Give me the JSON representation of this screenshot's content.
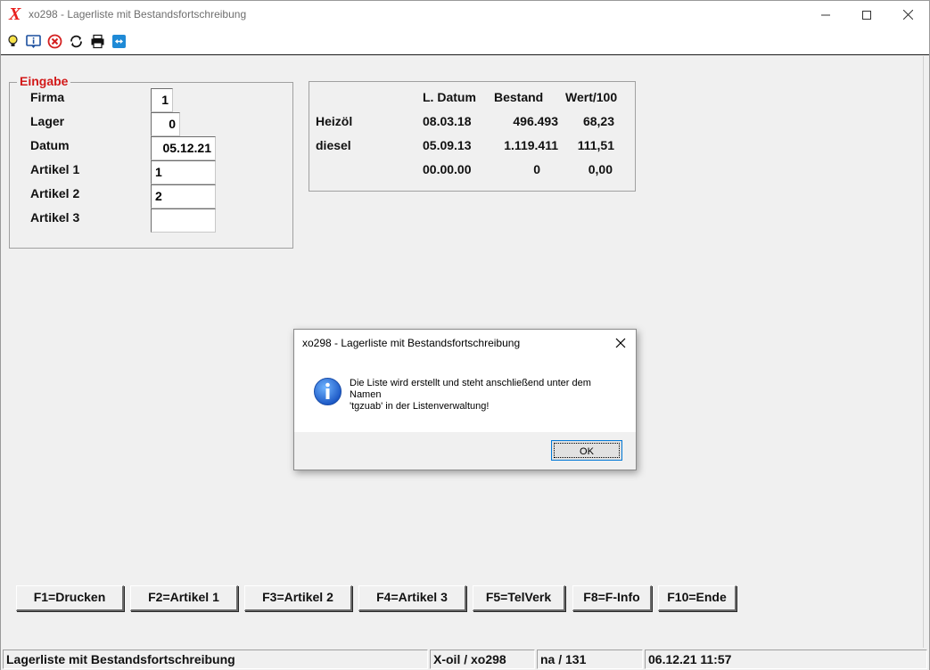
{
  "window": {
    "title": "xo298 - Lagerliste mit Bestandsfortschreibung",
    "logo": "X"
  },
  "toolbar": {
    "icons": [
      "lightbulb-icon",
      "info-icon",
      "cancel-icon",
      "refresh-icon",
      "printer-icon",
      "remote-icon"
    ]
  },
  "eingabe": {
    "legend": "Eingabe",
    "fields": [
      {
        "label": "Firma",
        "value": "1"
      },
      {
        "label": "Lager",
        "value": "0"
      },
      {
        "label": "Datum",
        "value": "05.12.21"
      },
      {
        "label": "Artikel 1",
        "value": "1"
      },
      {
        "label": "Artikel 2",
        "value": "2"
      },
      {
        "label": "Artikel 3",
        "value": ""
      }
    ]
  },
  "summary": {
    "headers": [
      "L. Datum",
      "Bestand",
      "Wert/100"
    ],
    "rows": [
      {
        "name": "Heizöl",
        "date": "08.03.18",
        "stock": "496.493",
        "value": "68,23"
      },
      {
        "name": "diesel",
        "date": "05.09.13",
        "stock": "1.119.411",
        "value": "111,51"
      },
      {
        "name": "",
        "date": "00.00.00",
        "stock": "0",
        "value": "0,00"
      }
    ]
  },
  "dialog": {
    "title": "xo298 - Lagerliste mit Bestandsfortschreibung",
    "message_lines": [
      "Die Liste wird erstellt und steht anschließend unter dem",
      "Namen",
      "'tgzuab' in der Listenverwaltung!"
    ],
    "ok_label": "OK"
  },
  "function_buttons": [
    {
      "label": "F1=Drucken"
    },
    {
      "label": "F2=Artikel 1"
    },
    {
      "label": "F3=Artikel 2"
    },
    {
      "label": "F4=Artikel 3"
    },
    {
      "label": "F5=TelVerk"
    },
    {
      "label": "F8=F-Info"
    },
    {
      "label": "F10=Ende"
    }
  ],
  "statusbar": {
    "program": "Lagerliste mit Bestandsfortschreibung",
    "app": "X-oil / xo298",
    "user": "na / 131",
    "datetime": "06.12.21 11:57"
  }
}
